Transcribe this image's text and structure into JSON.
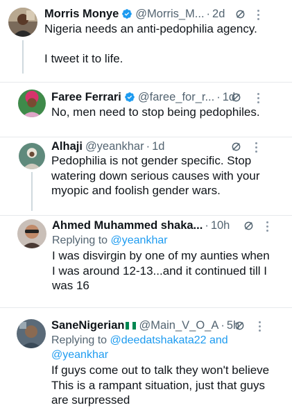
{
  "tweets": [
    {
      "name": "Morris Monye",
      "verified": true,
      "handle": "@Morris_M...",
      "dot": "·",
      "time": "2d",
      "lines": [
        "Nigeria needs an anti-pedophilia agency.",
        "",
        "I tweet it to life."
      ]
    },
    {
      "name": "Faree Ferrari",
      "verified": true,
      "handle": "@faree_for_r...",
      "dot": "·",
      "time": "1d",
      "lines": [
        "No, men need to stop being pedophiles."
      ]
    },
    {
      "name": "Alhaji",
      "verified": false,
      "handle": "@yeankhar",
      "dot": "·",
      "time": "1d",
      "lines": [
        "Pedophilia is not gender specific. Stop",
        "watering down serious causes with your",
        "myopic and foolish gender wars."
      ]
    },
    {
      "name": "Ahmed Muhammed shaka...",
      "verified": false,
      "handle": "",
      "dot": "·",
      "time": "10h",
      "replying_prefix": "Replying to",
      "replying_to": "@yeankhar",
      "lines": [
        "I was disvirgin by one of my aunties when",
        "I was around 12-13...and it continued till I",
        "was  16"
      ]
    },
    {
      "name": "SaneNigerian",
      "verified": false,
      "handle": "@Main_V_O_A",
      "dot": "·",
      "time": "5h",
      "replying_prefix": "Replying to",
      "replying_to": "@deedatshakata22",
      "replying_and": "and",
      "replying_to_2": "@yeankhar",
      "lines": [
        "If guys come out to talk they won't believe",
        "This is a rampant situation, just that guys",
        "are surpressed"
      ]
    }
  ],
  "colors": {
    "link": "#1d9bf0",
    "secondary": "#536471",
    "verified": "#1d9bf0",
    "thread_line": "#cfd9de"
  },
  "icons": {
    "verified": "verified-badge-icon",
    "grok": "grok-icon",
    "more": "more-options-icon",
    "flag": "nigeria-flag-icon"
  }
}
